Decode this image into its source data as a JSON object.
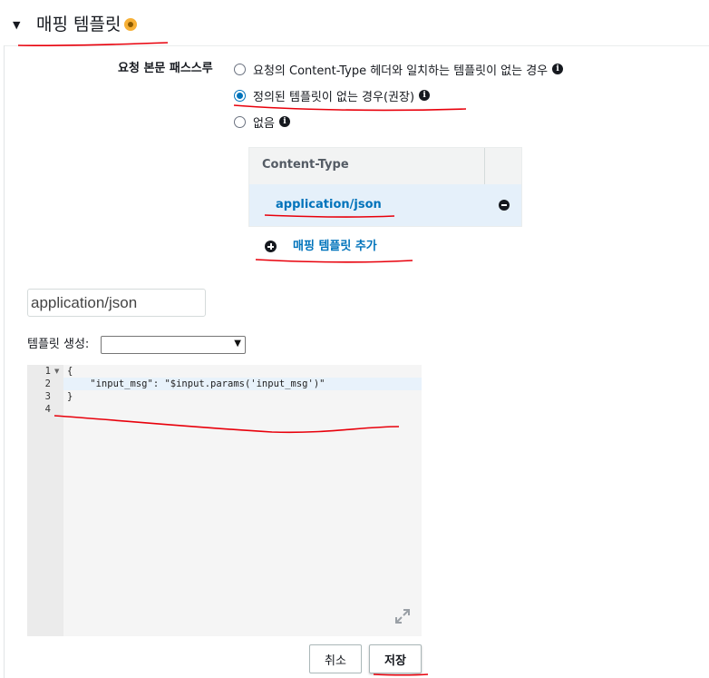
{
  "section": {
    "title": "매핑 템플릿",
    "toggle_icon": "caret-down-icon",
    "badge_color": "#f7b036"
  },
  "passthrough": {
    "label": "요청 본문 패스스루",
    "options": [
      {
        "label": "요청의 Content-Type 헤더와 일치하는 템플릿이 없는 경우",
        "selected": false
      },
      {
        "label": "정의된 템플릿이 없는 경우(권장)",
        "selected": true
      },
      {
        "label": "없음",
        "selected": false
      }
    ]
  },
  "content_type_table": {
    "header": "Content-Type",
    "rows": [
      {
        "label": "application/json"
      }
    ]
  },
  "add_template": {
    "label": "매핑 템플릿 추가"
  },
  "content_type_input": {
    "value": "application/json"
  },
  "generate_template": {
    "label": "템플릿 생성:",
    "selected": ""
  },
  "editor": {
    "line_numbers": [
      "1",
      "2",
      "3",
      "4"
    ],
    "lines": [
      "{",
      "    \"input_msg\": \"$input.params('input_msg')\"",
      "}",
      ""
    ]
  },
  "buttons": {
    "cancel": "취소",
    "save": "저장"
  },
  "colors": {
    "link": "#0073bb",
    "annotation": "#e8000b",
    "selected_row": "#e5f0fa"
  }
}
